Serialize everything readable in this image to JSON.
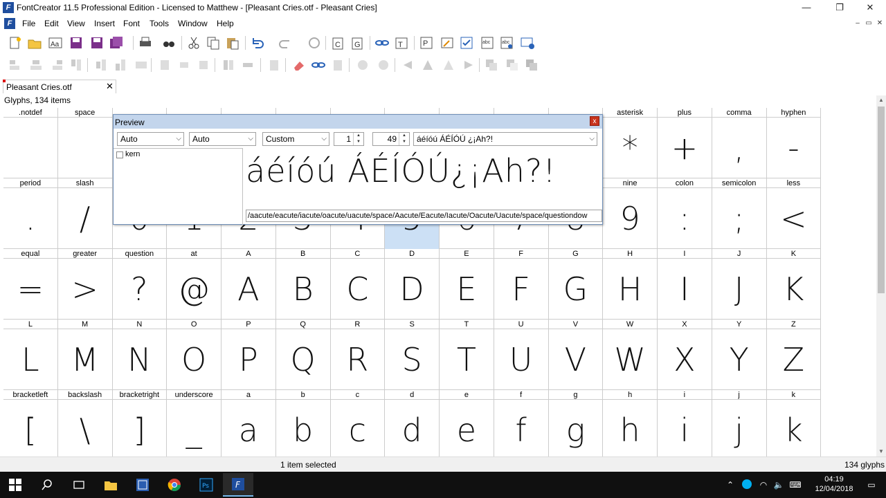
{
  "window": {
    "title": "FontCreator 11.5 Professional Edition - Licensed to Matthew - [Pleasant Cries.otf - Pleasant Cries]",
    "app_icon_letter": "F",
    "controls": {
      "minimize": "—",
      "maximize": "❐",
      "close": "✕"
    }
  },
  "menu": {
    "items": [
      "File",
      "Edit",
      "View",
      "Insert",
      "Font",
      "Tools",
      "Window",
      "Help"
    ],
    "mdi": {
      "minimize": "–",
      "restore": "▭",
      "close": "✕"
    }
  },
  "toolbar1_icons": [
    "new-font-icon",
    "open-icon",
    "font-preview-icon",
    "save-icon",
    "save-as-icon",
    "save-all-icon",
    "print-icon",
    "find-icon",
    "cut-icon",
    "copy-icon",
    "paste-icon",
    "undo-icon",
    "redo-icon",
    "reload-icon",
    "insert-character-icon",
    "insert-glyph-icon",
    "link-icon",
    "transform-icon",
    "properties-icon",
    "edit-icon",
    "validate-icon",
    "spell-check-icon",
    "spell-options-icon",
    "preview-window-icon"
  ],
  "toolbar2_icons": [
    "align-left-icon",
    "align-center-icon",
    "align-right-icon",
    "align-top-icon",
    "align-middle-icon",
    "align-bottom-icon",
    "distribute-icon",
    "distribute-center-icon",
    "distribute-right-icon",
    "flip-icon",
    "mirror-icon",
    "clipboard-icon",
    "eraser-icon",
    "break-link-icon",
    "decompose-icon",
    "combine-icon",
    "intersect-icon",
    "arrow-left-icon",
    "triangle-left-icon",
    "triangle-right-icon",
    "arrow-right-icon",
    "union-icon",
    "subtract-icon",
    "exclude-icon"
  ],
  "document_tab": {
    "label": "Pleasant Cries.otf",
    "close": "✕"
  },
  "glyph_header": "Glyphs, 134 items",
  "glyph_grid": [
    [
      {
        "name": ".notdef",
        "glyph": ""
      },
      {
        "name": "space",
        "glyph": ""
      },
      {
        "name": "",
        "glyph": ""
      },
      {
        "name": "",
        "glyph": ""
      },
      {
        "name": "",
        "glyph": ""
      },
      {
        "name": "",
        "glyph": ""
      },
      {
        "name": "",
        "glyph": ""
      },
      {
        "name": "",
        "glyph": ""
      },
      {
        "name": "",
        "glyph": ""
      },
      {
        "name": "",
        "glyph": ""
      },
      {
        "name": "",
        "glyph": ""
      },
      {
        "name": "asterisk",
        "glyph": "*"
      },
      {
        "name": "plus",
        "glyph": "+"
      },
      {
        "name": "comma",
        "glyph": ","
      },
      {
        "name": "hyphen",
        "glyph": "-"
      }
    ],
    [
      {
        "name": "period",
        "glyph": "."
      },
      {
        "name": "slash",
        "glyph": "/"
      },
      {
        "name": "",
        "glyph": "0"
      },
      {
        "name": "",
        "glyph": "1"
      },
      {
        "name": "",
        "glyph": "2"
      },
      {
        "name": "",
        "glyph": "3"
      },
      {
        "name": "",
        "glyph": "4"
      },
      {
        "name": "",
        "glyph": "5"
      },
      {
        "name": "",
        "glyph": "6"
      },
      {
        "name": "",
        "glyph": "7"
      },
      {
        "name": "",
        "glyph": "8"
      },
      {
        "name": "nine",
        "glyph": "9"
      },
      {
        "name": "colon",
        "glyph": ":"
      },
      {
        "name": "semicolon",
        "glyph": ";"
      },
      {
        "name": "less",
        "glyph": "<"
      }
    ],
    [
      {
        "name": "equal",
        "glyph": "="
      },
      {
        "name": "greater",
        "glyph": ">"
      },
      {
        "name": "question",
        "glyph": "?"
      },
      {
        "name": "at",
        "glyph": "@"
      },
      {
        "name": "A",
        "glyph": "A"
      },
      {
        "name": "B",
        "glyph": "B"
      },
      {
        "name": "C",
        "glyph": "C"
      },
      {
        "name": "D",
        "glyph": "D"
      },
      {
        "name": "E",
        "glyph": "E"
      },
      {
        "name": "F",
        "glyph": "F"
      },
      {
        "name": "G",
        "glyph": "G"
      },
      {
        "name": "H",
        "glyph": "H"
      },
      {
        "name": "I",
        "glyph": "I"
      },
      {
        "name": "J",
        "glyph": "J"
      },
      {
        "name": "K",
        "glyph": "K"
      }
    ],
    [
      {
        "name": "L",
        "glyph": "L"
      },
      {
        "name": "M",
        "glyph": "M"
      },
      {
        "name": "N",
        "glyph": "N"
      },
      {
        "name": "O",
        "glyph": "O"
      },
      {
        "name": "P",
        "glyph": "P"
      },
      {
        "name": "Q",
        "glyph": "Q"
      },
      {
        "name": "R",
        "glyph": "R"
      },
      {
        "name": "S",
        "glyph": "S"
      },
      {
        "name": "T",
        "glyph": "T"
      },
      {
        "name": "U",
        "glyph": "U"
      },
      {
        "name": "V",
        "glyph": "V"
      },
      {
        "name": "W",
        "glyph": "W"
      },
      {
        "name": "X",
        "glyph": "X"
      },
      {
        "name": "Y",
        "glyph": "Y"
      },
      {
        "name": "Z",
        "glyph": "Z"
      }
    ],
    [
      {
        "name": "bracketleft",
        "glyph": "["
      },
      {
        "name": "backslash",
        "glyph": "\\"
      },
      {
        "name": "bracketright",
        "glyph": "]"
      },
      {
        "name": "underscore",
        "glyph": "_"
      },
      {
        "name": "a",
        "glyph": "a"
      },
      {
        "name": "b",
        "glyph": "b"
      },
      {
        "name": "c",
        "glyph": "c"
      },
      {
        "name": "d",
        "glyph": "d"
      },
      {
        "name": "e",
        "glyph": "e"
      },
      {
        "name": "f",
        "glyph": "f"
      },
      {
        "name": "g",
        "glyph": "g"
      },
      {
        "name": "h",
        "glyph": "h"
      },
      {
        "name": "i",
        "glyph": "i"
      },
      {
        "name": "j",
        "glyph": "j"
      },
      {
        "name": "k",
        "glyph": "k"
      }
    ]
  ],
  "preview": {
    "title": "Preview",
    "close": "x",
    "combo1": "Auto",
    "combo2": "Auto",
    "combo3": "Custom",
    "spin1": "1",
    "spin2": "49",
    "sample_text": "áéíóú ÁÉÍÓÚ ¿¡Ah?!",
    "kern_label": "kern",
    "rendered_text": "áéíóú ÁÉÍÓÚ¿¡Ah?!",
    "glyph_names": "/aacute/eacute/iacute/oacute/uacute/space/Aacute/Eacute/Iacute/Oacute/Uacute/space/questiondow"
  },
  "status": {
    "selection": "1 item selected",
    "count": "134 glyphs"
  },
  "taskbar": {
    "apps": [
      "windows-start-icon",
      "search-icon",
      "task-view-icon",
      "file-explorer-icon",
      "fontcreator-app-icon",
      "chrome-icon",
      "photoshop-icon",
      "fontcreator-active-icon"
    ],
    "time": "04:19",
    "date": "12/04/2018"
  },
  "colors": {
    "selection": "#cce0f5",
    "preview_title": "#c3d5ec",
    "close_red": "#c8341e",
    "taskbar": "#101010"
  }
}
